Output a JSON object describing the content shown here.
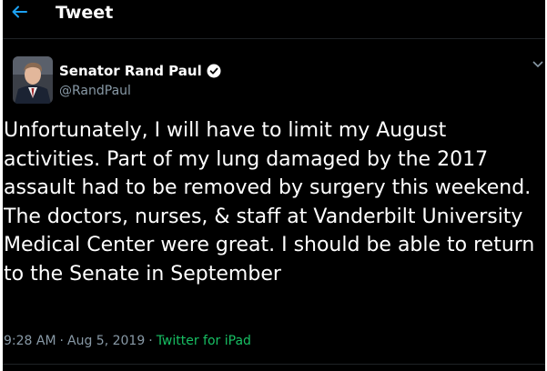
{
  "header": {
    "title": "Tweet",
    "back_icon": "arrow-left-icon"
  },
  "tweet": {
    "author": {
      "name": "Senator Rand Paul",
      "handle": "@RandPaul",
      "verified_icon": "verified-badge-icon"
    },
    "menu_icon": "chevron-down-icon",
    "text": "Unfortunately, I will have to limit my August activities. Part of my lung damaged by the 2017 assault had to be removed by surgery this weekend. The doctors, nurses, & staff at Vanderbilt University Medical Center were great. I should be able to return to the Senate in September",
    "time": "9:28 AM",
    "date": "Aug 5, 2019",
    "source": "Twitter for iPad",
    "separator": "·"
  },
  "colors": {
    "background": "#000000",
    "text": "#ffffff",
    "secondary": "#8899a6",
    "accent": "#1da1f2",
    "source": "#17bf63"
  }
}
